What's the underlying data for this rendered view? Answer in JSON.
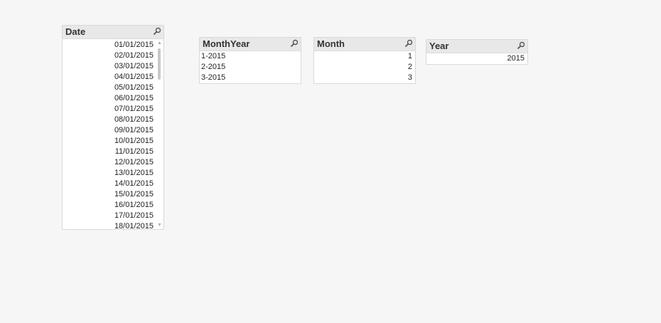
{
  "date_box": {
    "title": "Date",
    "items": [
      "01/01/2015",
      "02/01/2015",
      "03/01/2015",
      "04/01/2015",
      "05/01/2015",
      "06/01/2015",
      "07/01/2015",
      "08/01/2015",
      "09/01/2015",
      "10/01/2015",
      "11/01/2015",
      "12/01/2015",
      "13/01/2015",
      "14/01/2015",
      "15/01/2015",
      "16/01/2015",
      "17/01/2015",
      "18/01/2015"
    ]
  },
  "monthyear_box": {
    "title": "MonthYear",
    "items": [
      "1-2015",
      "2-2015",
      "3-2015"
    ]
  },
  "month_box": {
    "title": "Month",
    "items": [
      "1",
      "2",
      "3"
    ]
  },
  "year_box": {
    "title": "Year",
    "items": [
      "2015"
    ]
  },
  "icons": {
    "search": "search-icon",
    "scroll_up": "scroll-up-icon",
    "scroll_down": "scroll-down-icon"
  },
  "colors": {
    "background": "#f6f6f6",
    "header": "#e8e8e8",
    "list": "#ffffff"
  }
}
